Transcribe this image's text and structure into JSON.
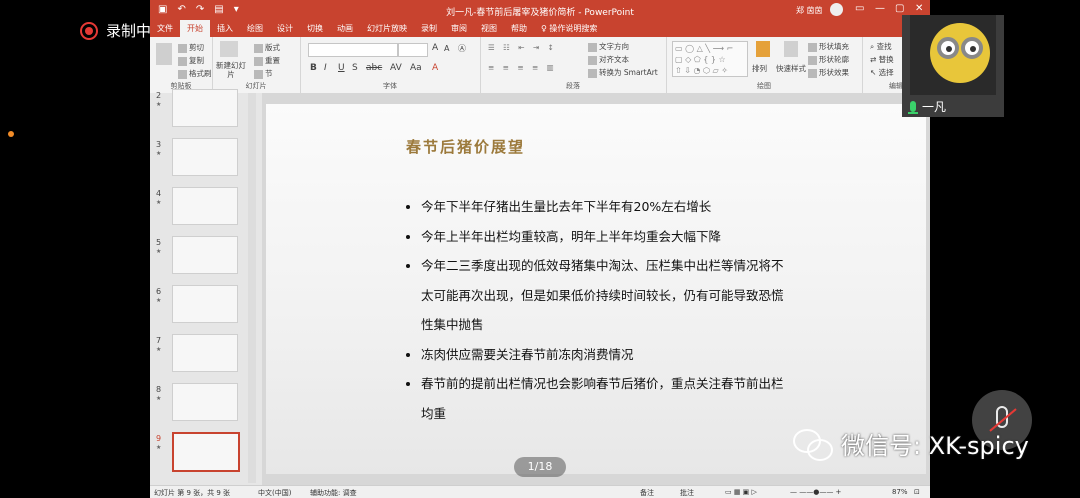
{
  "recording": {
    "label": "录制中"
  },
  "window": {
    "title": "刘一凡-春节前后屠宰及猪价简析 - PowerPoint",
    "user": "郑 茵茵",
    "controls": {
      "minimize": "—",
      "restore": "▢",
      "close": "✕"
    }
  },
  "ribbon_tabs": [
    "文件",
    "开始",
    "插入",
    "绘图",
    "设计",
    "切换",
    "动画",
    "幻灯片放映",
    "录制",
    "审阅",
    "视图",
    "帮助"
  ],
  "ribbon_tab_active": "开始",
  "tell_me": "操作说明搜索",
  "ribbon": {
    "clipboard": {
      "label": "剪贴板",
      "cut": "剪切",
      "copy": "复制",
      "format_painter": "格式刷"
    },
    "slides": {
      "label": "幻灯片",
      "new_slide": "新建幻灯片",
      "layout": "版式",
      "reset": "重置",
      "section": "节"
    },
    "font": {
      "label": "字体",
      "bold": "B",
      "italic": "I",
      "underline": "U",
      "strike": "S",
      "clear": "A"
    },
    "paragraph": {
      "label": "段落",
      "text_direction": "文字方向",
      "align_text": "对齐文本",
      "smartart": "转换为 SmartArt"
    },
    "drawing": {
      "label": "绘图",
      "arrange": "排列",
      "quick_styles": "快速样式",
      "shape_fill": "形状填充",
      "shape_outline": "形状轮廓",
      "shape_effects": "形状效果"
    },
    "editing": {
      "label": "编辑",
      "find": "查找",
      "replace": "替换",
      "select": "选择"
    }
  },
  "thumbnails": [
    {
      "num": "2"
    },
    {
      "num": "3"
    },
    {
      "num": "4"
    },
    {
      "num": "5"
    },
    {
      "num": "6"
    },
    {
      "num": "7"
    },
    {
      "num": "8"
    },
    {
      "num": "9",
      "selected": true
    }
  ],
  "slide": {
    "title": "春节后猪价展望",
    "bullets": [
      "今年下半年仔猪出生量比去年下半年有20%左右增长",
      "今年上半年出栏均重较高，明年上半年均重会大幅下降",
      "今年二三季度出现的低效母猪集中淘汰、压栏集中出栏等情况将不太可能再次出现，但是如果低价持续时间较长，仍有可能导致恐慌性集中抛售",
      "冻肉供应需要关注春节前冻肉消费情况",
      "春节前的提前出栏情况也会影响春节后猪价，重点关注春节前出栏均重"
    ]
  },
  "page_indicator": "1/18",
  "status_bar": {
    "slide_info": "幻灯片 第 9 张，共 9 张",
    "language": "中文(中国)",
    "accessibility": "辅助功能: 调查",
    "notes": "备注",
    "comments": "批注",
    "zoom": "87%"
  },
  "webcam": {
    "name": "一凡"
  },
  "watermark": {
    "text": "微信号: XK-spicy"
  },
  "colors": {
    "ppt_accent": "#c8432f",
    "title_gold": "#9c7a3c",
    "record_red": "#e53935",
    "mic_green": "#3ad06a"
  }
}
